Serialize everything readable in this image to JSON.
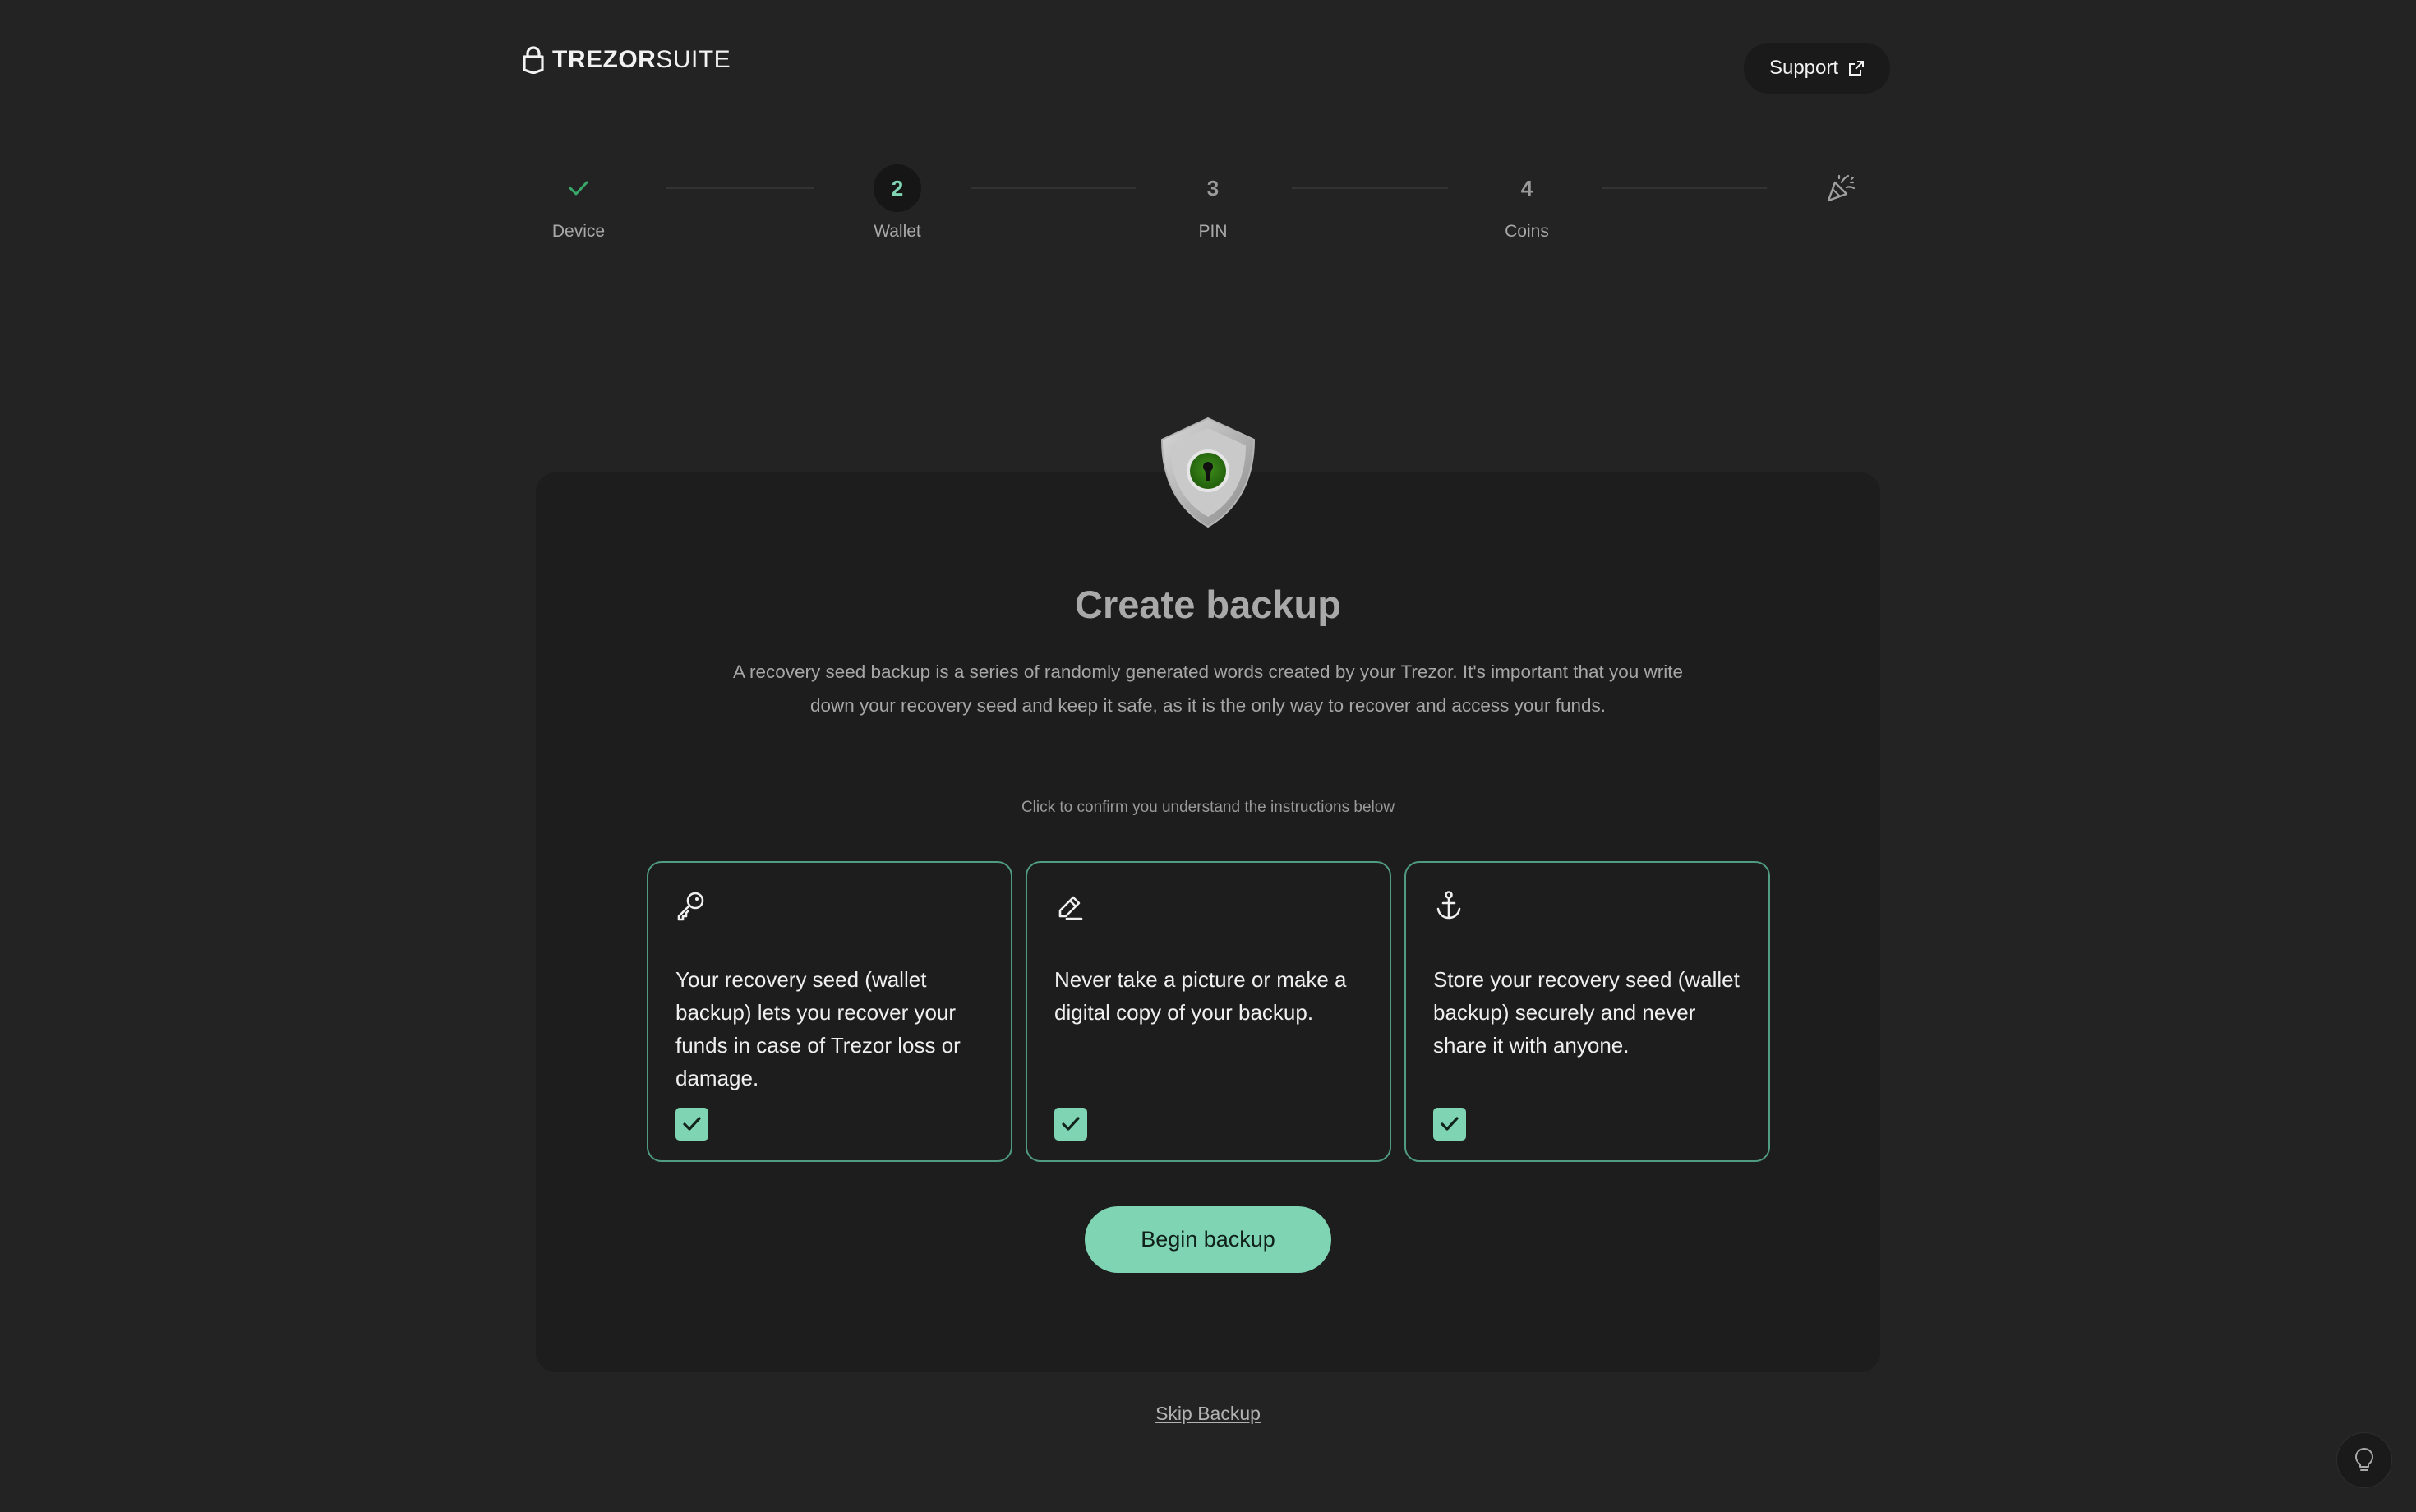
{
  "header": {
    "logo_bold": "TREZOR",
    "logo_light": "SUITE",
    "support_label": "Support"
  },
  "stepper": {
    "steps": [
      {
        "number": "",
        "label": "Device",
        "state": "done"
      },
      {
        "number": "2",
        "label": "Wallet",
        "state": "active"
      },
      {
        "number": "3",
        "label": "PIN",
        "state": "upcoming"
      },
      {
        "number": "4",
        "label": "Coins",
        "state": "upcoming"
      },
      {
        "number": "",
        "label": "",
        "state": "final",
        "icon": "party-popper-icon"
      }
    ]
  },
  "main": {
    "title": "Create backup",
    "description": "A recovery seed backup is a series of randomly generated words created by your Trezor. It's important that you write down your recovery seed and keep it safe, as it is the only way to recover and access your funds.",
    "hint": "Click to confirm you understand the instructions below",
    "tiles": [
      {
        "icon": "key-icon",
        "text": "Your recovery seed (wallet backup) lets you recover your funds in case of Trezor loss or damage.",
        "checked": true
      },
      {
        "icon": "pencil-icon",
        "text": "Never take a picture or make a digital copy of your backup.",
        "checked": true
      },
      {
        "icon": "anchor-icon",
        "text": "Store your recovery seed (wallet backup) securely and never share it with anyone.",
        "checked": true
      }
    ],
    "begin_label": "Begin backup",
    "skip_label": "Skip Backup"
  },
  "colors": {
    "background": "#232323",
    "card": "#1d1d1d",
    "accent": "#7fd4b3",
    "tile_border": "#4f9c80",
    "check_green": "#39a96b"
  }
}
